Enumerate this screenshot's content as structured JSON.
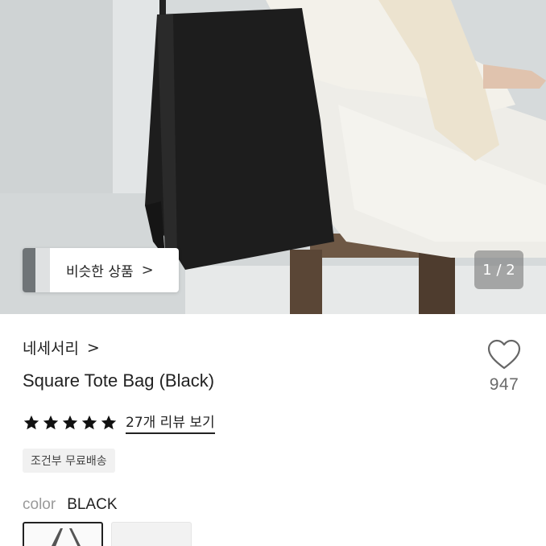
{
  "hero": {
    "similar_label": "비슷한 상품",
    "similar_chevron": ">",
    "page_indicator": "1 / 2"
  },
  "product": {
    "brand": "네세서리",
    "brand_chevron": ">",
    "title": "Square Tote Bag (Black)",
    "rating_stars": 5,
    "review_link": "27개 리뷰 보기",
    "shipping_badge": "조건부 무료배송",
    "likes": "947"
  },
  "options": {
    "color_label": "color",
    "color_value": "BLACK"
  },
  "colors": {
    "text": "#222222",
    "muted": "#9a9a9a",
    "like_count": "#6b6b6b",
    "badge_bg": "#f1f1f1"
  }
}
